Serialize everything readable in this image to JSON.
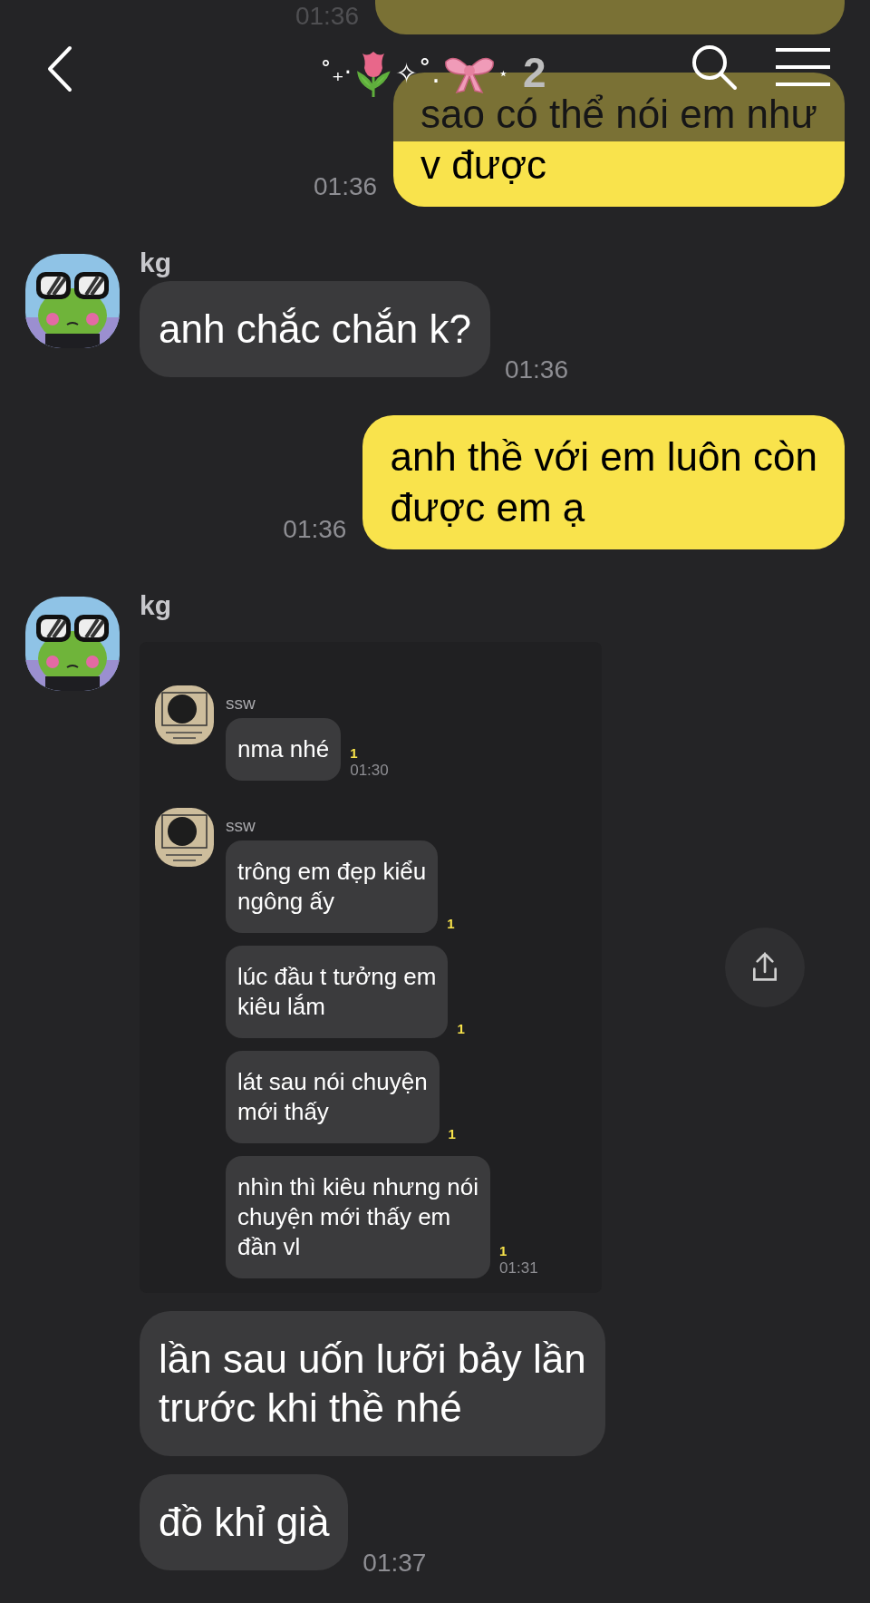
{
  "header": {
    "decor": [
      "˚₊‧",
      "✧˚.",
      "⋆"
    ],
    "count": "2"
  },
  "messages": [
    {
      "kind": "sent",
      "time": "01:36"
    },
    {
      "kind": "sent",
      "text": "sao có thể nói em như\nv được",
      "time": "01:36"
    },
    {
      "kind": "received",
      "sender": "kg",
      "items": [
        {
          "kind": "text",
          "text": "anh chắc chắn k?",
          "time": "01:36"
        }
      ]
    },
    {
      "kind": "sent",
      "text": "anh thề với em luôn còn\nđược em ạ",
      "time": "01:36"
    },
    {
      "kind": "received",
      "sender": "kg",
      "items": [
        {
          "kind": "screenshot",
          "groups": [
            {
              "sender": "ssw",
              "bubbles": [
                {
                  "text": "nma nhé",
                  "unread": "1",
                  "time": "01:30"
                }
              ]
            },
            {
              "sender": "ssw",
              "bubbles": [
                {
                  "text": "trông em đẹp kiểu\nngông ấy",
                  "unread": "1"
                },
                {
                  "text": "lúc đầu t tưởng em\nkiêu lắm",
                  "unread": "1"
                },
                {
                  "text": "lát sau nói chuyện\nmới thấy",
                  "unread": "1"
                },
                {
                  "text": "nhìn thì kiêu nhưng nói\nchuyện mới thấy em\nđần vl",
                  "unread": "1",
                  "time": "01:31"
                }
              ]
            }
          ]
        },
        {
          "kind": "text",
          "text": "lần sau uốn lưỡi bảy lần\ntrước khi thề nhé"
        },
        {
          "kind": "text",
          "text": "đồ khỉ già",
          "time": "01:37"
        }
      ]
    }
  ]
}
